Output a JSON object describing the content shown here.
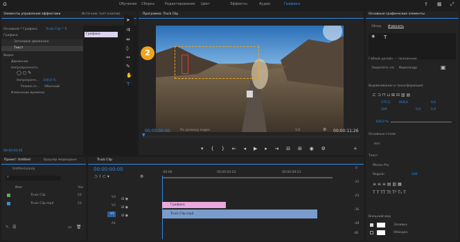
{
  "topbar": {
    "home_icon": "home-icon",
    "tabs": [
      "Обучение",
      "Сборка",
      "Редактирование",
      "Цвет",
      "Эффекты",
      "Аудио",
      "Графика"
    ],
    "active": "Графика",
    "right_icons": [
      "export-icon",
      "grid-icon",
      "maximize-icon"
    ]
  },
  "effect_controls": {
    "title": "Элементы управления эффектами",
    "tab2": "Источник: (нет клипов)",
    "master": "Основной * Графика",
    "clip": "Truck Clip * Tr",
    "clip_label": "Графика",
    "section_graphics": "Графика",
    "shape": "Заголовок движения",
    "text_layer": "Текст",
    "section_video": "Видео",
    "motion": "Движение",
    "opacity": "Непрозрачность",
    "opacity_param": "Непрозрачн...",
    "opacity_value": "100,0 %",
    "blend_mode_label": "Режим сл...",
    "blend_mode_value": "Обычный",
    "time_remap": "Изменение времени",
    "timecode": "00:00:00:00"
  },
  "tools": [
    "selection-tool",
    "track-select-tool",
    "ripple-tool",
    "razor-tool",
    "slip-tool",
    "pen-tool",
    "hand-tool",
    "type-tool"
  ],
  "program_monitor": {
    "title": "Программа: Truck Clip",
    "badge": "2",
    "timecode": "00:00:00:00",
    "fit": "По размеру кадра",
    "resolution": "1/2",
    "duration": "00:00:11;26"
  },
  "project": {
    "title": "Проект: Untitled",
    "tab2": "Браузер медиаданн",
    "file": "Untitled.prproj",
    "columns": [
      "Имя",
      "Час"
    ],
    "items": [
      {
        "name": "Truck Clip",
        "rate": "23",
        "color": "#6aa84f"
      },
      {
        "name": "Truck Clip.mp4",
        "rate": "23",
        "color": "#3b8bd4"
      }
    ]
  },
  "timeline": {
    "title": "Truck Clip",
    "timecode": "00:00:00:00",
    "ruler": [
      ":00:00",
      "00:00:04:23",
      "00:00:09:23"
    ],
    "tracks": [
      "V3",
      "V2",
      "V1",
      "A1",
      "A2"
    ],
    "clip_graphics": "Графика",
    "clip_video": "Truck Clip.mp4",
    "audio_db": [
      "0",
      "-12",
      "-24",
      "-36",
      "-48",
      "dB"
    ]
  },
  "essential_graphics": {
    "title": "Основные графические элементы",
    "tab_browse": "Обзор",
    "tab_edit": "Изменить",
    "layer_text": "T",
    "responsive_title": "Гибкий дизайн — положение",
    "pin_label": "Закрепить на:",
    "pin_value": "Видеокадр",
    "align_title": "Выравнивание и трансформация",
    "pos_x": "175,5",
    "pos_y": "828,6",
    "anchor_x": "0,0",
    "anchor_y": "0,0",
    "scale": "100",
    "rotation": "0,0",
    "opacity": "100,0 %",
    "styles_title": "Основные стили",
    "style_value": "Нет",
    "text_title": "Текст",
    "font": "Minion Pro",
    "font_style": "Regular",
    "font_size": "100",
    "appearance_title": "Внешний вид",
    "fill_label": "Заливка",
    "stroke_label": "Обводка"
  },
  "colors": {
    "accent": "#2d8ceb",
    "badge": "#f0a31c",
    "graphics_clip": "#e8a8e0",
    "video_clip": "#7a9ccc"
  }
}
